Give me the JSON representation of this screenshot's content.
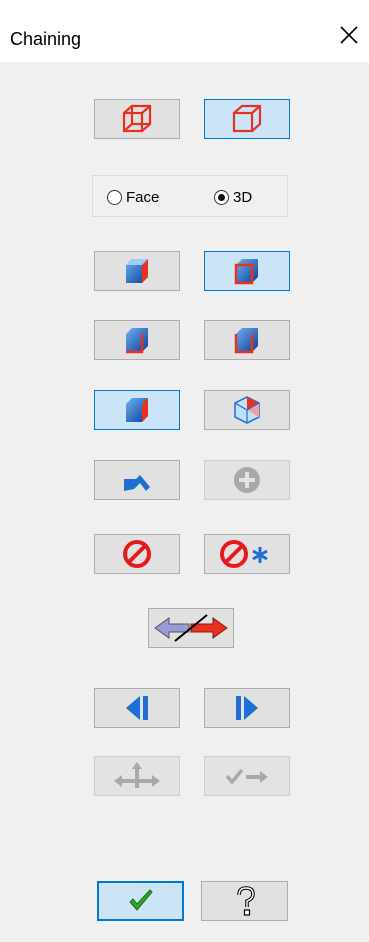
{
  "window": {
    "title": "Chaining"
  },
  "selection_mode": {
    "options": [
      {
        "label": "Face",
        "selected": false
      },
      {
        "label": "3D",
        "selected": true
      }
    ]
  },
  "colors": {
    "accent": "#0078d7",
    "active_bg": "#cce4f7",
    "icon_red": "#e8311f",
    "icon_blue": "#1c6fd3"
  },
  "buttons": [
    {
      "icon": "wireframe-cube-icon",
      "state": "normal"
    },
    {
      "icon": "solid-cube-icon",
      "state": "active"
    },
    {
      "icon": "solid-body-icon",
      "state": "normal"
    },
    {
      "icon": "face-loop-icon",
      "state": "active"
    },
    {
      "icon": "edge-chain-icon",
      "state": "normal"
    },
    {
      "icon": "loop-chain-icon",
      "state": "normal"
    },
    {
      "icon": "face-select-icon",
      "state": "active"
    },
    {
      "icon": "vertex-select-icon",
      "state": "normal"
    },
    {
      "icon": "undo-arrow-icon",
      "state": "normal"
    },
    {
      "icon": "add-icon",
      "state": "disabled"
    },
    {
      "icon": "cancel-icon",
      "state": "normal"
    },
    {
      "icon": "cancel-all-icon",
      "state": "normal"
    },
    {
      "icon": "reverse-direction-icon",
      "state": "normal"
    },
    {
      "icon": "previous-icon",
      "state": "normal"
    },
    {
      "icon": "next-icon",
      "state": "normal"
    },
    {
      "icon": "move-icon",
      "state": "disabled"
    },
    {
      "icon": "end-chain-icon",
      "state": "disabled"
    },
    {
      "icon": "ok-check-icon",
      "state": "active"
    },
    {
      "icon": "help-icon",
      "state": "normal"
    }
  ]
}
